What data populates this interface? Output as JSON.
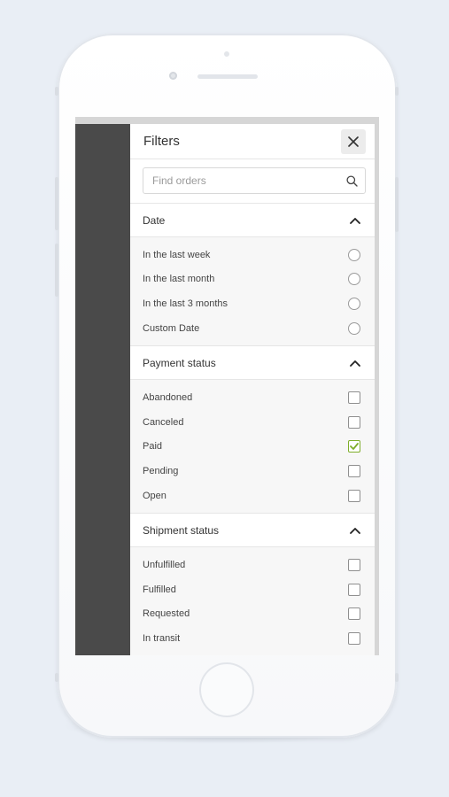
{
  "panel": {
    "title": "Filters",
    "close_icon": "close-icon"
  },
  "search": {
    "placeholder": "Find orders",
    "value": "",
    "icon": "search-icon"
  },
  "colors": {
    "accent_check": "#7fae2a",
    "sidebar_dark": "#4a4a4a"
  },
  "sections": {
    "date": {
      "title": "Date",
      "expanded": true,
      "options": [
        {
          "label": "In the last week",
          "selected": false
        },
        {
          "label": "In the last month",
          "selected": false
        },
        {
          "label": "In the last 3 months",
          "selected": false
        },
        {
          "label": "Custom Date",
          "selected": false
        }
      ]
    },
    "payment": {
      "title": "Payment status",
      "expanded": true,
      "options": [
        {
          "label": "Abandoned",
          "checked": false
        },
        {
          "label": "Canceled",
          "checked": false
        },
        {
          "label": "Paid",
          "checked": true
        },
        {
          "label": "Pending",
          "checked": false
        },
        {
          "label": "Open",
          "checked": false
        }
      ]
    },
    "shipment": {
      "title": "Shipment status",
      "expanded": true,
      "options": [
        {
          "label": "Unfulfilled",
          "checked": false
        },
        {
          "label": "Fulfilled",
          "checked": false
        },
        {
          "label": "Requested",
          "checked": false
        },
        {
          "label": "In transit",
          "checked": false
        }
      ]
    }
  }
}
